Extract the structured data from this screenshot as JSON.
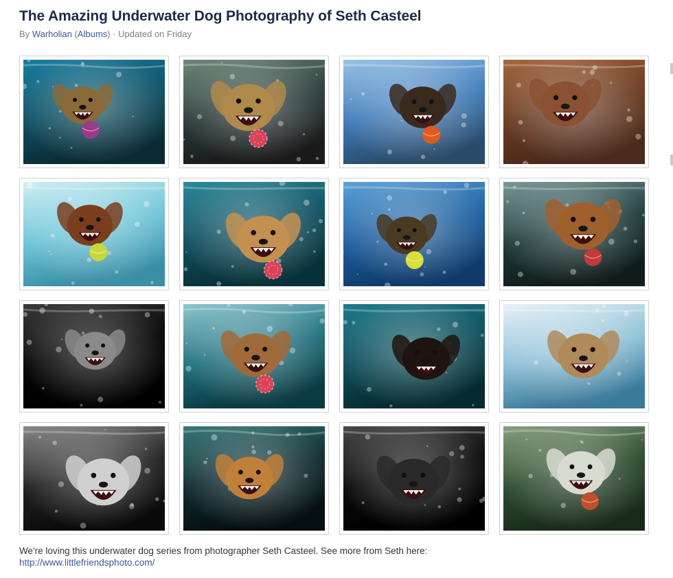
{
  "album": {
    "title": "The Amazing Underwater Dog Photography of Seth Casteel",
    "meta": {
      "by": "By ",
      "author": "Warholian",
      "open_paren": " (",
      "albums_link": "Albums",
      "close_paren": ")",
      "separator": " · ",
      "updated": "Updated on Friday"
    }
  },
  "photos": [
    {
      "bg": [
        "#0d4f63",
        "#1a7da0",
        "#0a2a33"
      ],
      "dog": "#8a6a3a",
      "ball": "#9a3a8a",
      "ball_style": "solid"
    },
    {
      "bg": [
        "#2a3a3a",
        "#6e8a7a",
        "#1a1a1a"
      ],
      "dog": "#b08a4a",
      "ball": "#d9435a",
      "ball_style": "net"
    },
    {
      "bg": [
        "#3e7ab8",
        "#9ac4e8",
        "#2a4a6a"
      ],
      "dog": "#3a2a1e",
      "ball": "#e05a1a",
      "ball_style": "solid"
    },
    {
      "bg": [
        "#6a3a22",
        "#a5683f",
        "#4a2a1a"
      ],
      "dog": "#8a5232",
      "ball": "",
      "ball_style": "none"
    },
    {
      "bg": [
        "#6cc4d8",
        "#d0eef4",
        "#3a8ea6"
      ],
      "dog": "#7a3e1e",
      "ball": "#c8d83a",
      "ball_style": "solid"
    },
    {
      "bg": [
        "#0f4e5e",
        "#2c8a9a",
        "#083038"
      ],
      "dog": "#c49050",
      "ball": "#d9435a",
      "ball_style": "net"
    },
    {
      "bg": [
        "#1c5e9e",
        "#5ea2d8",
        "#0e3a6a"
      ],
      "dog": "#4a3a22",
      "ball": "#d8e03a",
      "ball_style": "solid"
    },
    {
      "bg": [
        "#1e3a3a",
        "#7a9a9a",
        "#101c1c"
      ],
      "dog": "#a0602e",
      "ball": "#c03a3a",
      "ball_style": "solid"
    },
    {
      "bg": [
        "#050505",
        "#3a3a3a",
        "#000000"
      ],
      "dog": "#8a8a8a",
      "ball": "",
      "ball_style": "none"
    },
    {
      "bg": [
        "#1e6e7a",
        "#8ec8d0",
        "#0a3a42"
      ],
      "dog": "#a06a3a",
      "ball": "#d9435a",
      "ball_style": "net"
    },
    {
      "bg": [
        "#0e4e5a",
        "#1e7a8a",
        "#062a30"
      ],
      "dog": "#1e1410",
      "ball": "",
      "ball_style": "none"
    },
    {
      "bg": [
        "#8ec0d8",
        "#e8f2f6",
        "#3a7a9a"
      ],
      "dog": "#b08a5a",
      "ball": "",
      "ball_style": "none"
    },
    {
      "bg": [
        "#202020",
        "#8a8a8a",
        "#0a0a0a"
      ],
      "dog": "#d0d0d0",
      "ball": "",
      "ball_style": "none"
    },
    {
      "bg": [
        "#0e2a2e",
        "#3a7a7a",
        "#050e10"
      ],
      "dog": "#c0803a",
      "ball": "",
      "ball_style": "none"
    },
    {
      "bg": [
        "#0a0a0a",
        "#4a4a4a",
        "#000000"
      ],
      "dog": "#2a2a2a",
      "ball": "",
      "ball_style": "none"
    },
    {
      "bg": [
        "#2a4a2e",
        "#8aa080",
        "#1a2a1a"
      ],
      "dog": "#d8dcd0",
      "ball": "#c0502a",
      "ball_style": "solid"
    }
  ],
  "caption": {
    "text": "We're loving this underwater dog series from photographer Seth Casteel. See more from Seth here: ",
    "link": "http://www.littlefriendsphoto.com/"
  }
}
